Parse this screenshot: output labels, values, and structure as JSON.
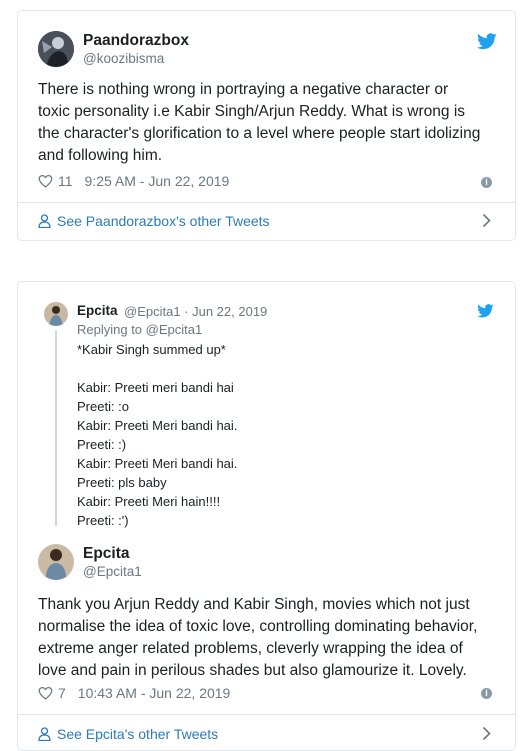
{
  "tweet1": {
    "name": "Paandorazbox",
    "handle": "@koozibisma",
    "text_lines": [
      "There is nothing wrong in portraying a negative character or",
      "toxic personality i.e Kabir Singh/Arjun Reddy. What is wrong is",
      "the character's glorification to a level where people start idolizing",
      "and following him."
    ],
    "likes": "11",
    "timestamp": "9:25 AM - Jun 22, 2019",
    "see_more": "See Paandorazbox's other Tweets"
  },
  "tweet2": {
    "quoted": {
      "name": "Epcita",
      "handle_date": "@Epcita1 · Jun 22, 2019",
      "replying_to": "Replying to @Epcita1",
      "lines": [
        "*Kabir Singh summed up*",
        "",
        "Kabir: Preeti meri bandi hai",
        "Preeti: :o",
        "Kabir: Preeti Meri bandi hai.",
        "Preeti: :)",
        "Kabir: Preeti Meri bandi hai.",
        "Preeti: pls baby",
        "Kabir: Preeti Meri hain!!!!",
        "Preeti: :')"
      ]
    },
    "name": "Epcita",
    "handle": "@Epcita1",
    "text_lines": [
      "Thank you Arjun Reddy and Kabir Singh, movies which not just",
      "normalise the idea of toxic love, controlling dominating behavior,",
      "extreme anger related problems, cleverly wrapping the idea of",
      "love and pain in perilous shades but also glamourize it. Lovely."
    ],
    "likes": "7",
    "timestamp": "10:43 AM - Jun 22, 2019",
    "see_more": "See Epcita's other Tweets"
  },
  "colors": {
    "twitter_blue": "#1da1f2",
    "link": "#2b7bb9",
    "muted": "#697882",
    "border": "#e1e8ed"
  },
  "icons": [
    "twitter-bird-icon",
    "heart-icon",
    "info-icon",
    "person-icon",
    "chevron-right-icon"
  ]
}
